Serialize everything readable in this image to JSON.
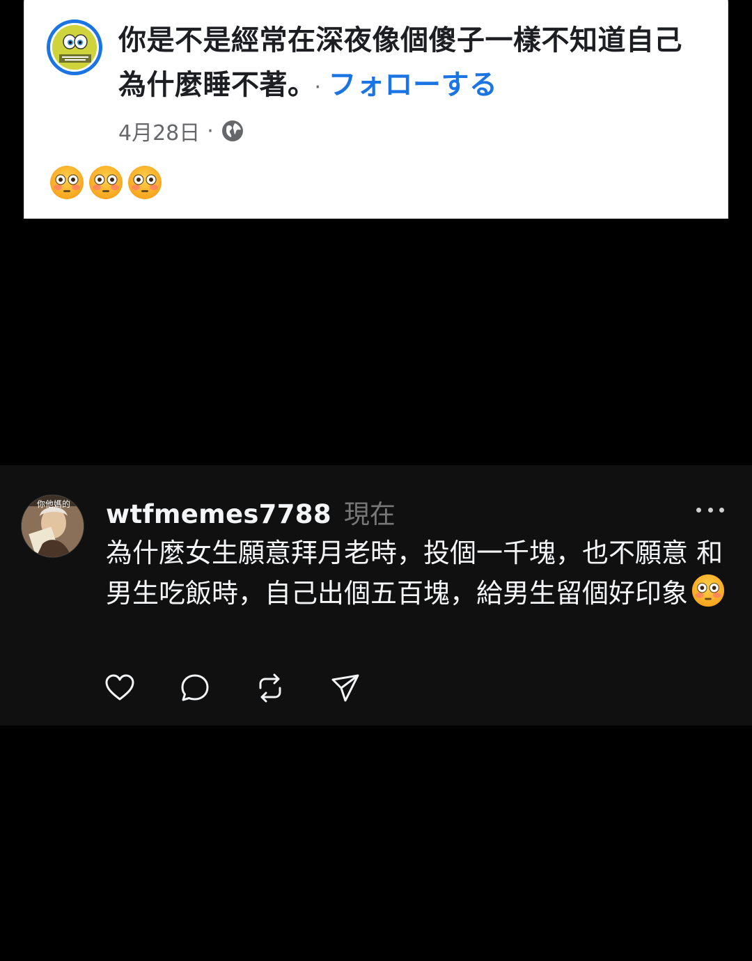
{
  "facebook_post": {
    "title": "你是不是經常在深夜像個傻子一樣不知道自己為什麼睡不著。",
    "follow_separator": "·",
    "follow_label": "フォローする",
    "date": "4月28日",
    "meta_separator": "·",
    "privacy_icon": "globe-icon",
    "body_emojis": [
      "flushed-face",
      "flushed-face",
      "flushed-face"
    ],
    "accent_color": "#1b74e4"
  },
  "threads_reply": {
    "avatar_caption": "你他媽的",
    "username": "wtfmemes7788",
    "time": "現在",
    "more_icon": "ellipsis-icon",
    "text": "為什麼女生願意拜月老時，投個一千塊，也不願意 和男生吃飯時，自己出個五百塊，給男生留個好印象",
    "trailing_emoji": "flushed-face",
    "actions": [
      "heart-icon",
      "comment-icon",
      "repost-icon",
      "share-icon"
    ]
  }
}
